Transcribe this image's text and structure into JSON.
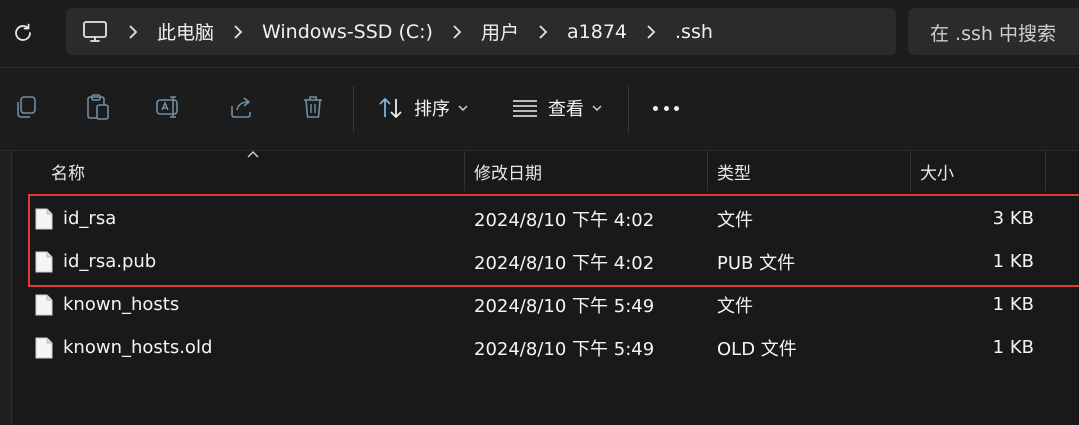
{
  "breadcrumb": {
    "items": [
      "此电脑",
      "Windows-SSD (C:)",
      "用户",
      "a1874",
      ".ssh"
    ]
  },
  "search": {
    "placeholder": "在 .ssh 中搜索"
  },
  "toolbar": {
    "sort_label": "排序",
    "view_label": "查看"
  },
  "columns": {
    "name": "名称",
    "date": "修改日期",
    "type": "类型",
    "size": "大小"
  },
  "files": [
    {
      "name": "id_rsa",
      "date": "2024/8/10 下午 4:02",
      "type": "文件",
      "size": "3 KB"
    },
    {
      "name": "id_rsa.pub",
      "date": "2024/8/10 下午 4:02",
      "type": "PUB 文件",
      "size": "1 KB"
    },
    {
      "name": "known_hosts",
      "date": "2024/8/10 下午 5:49",
      "type": "文件",
      "size": "1 KB"
    },
    {
      "name": "known_hosts.old",
      "date": "2024/8/10 下午 5:49",
      "type": "OLD 文件",
      "size": "1 KB"
    }
  ],
  "colors": {
    "background": "#1c1c1c",
    "panel": "#2b2b2b",
    "highlight_box": "#e0393c"
  }
}
